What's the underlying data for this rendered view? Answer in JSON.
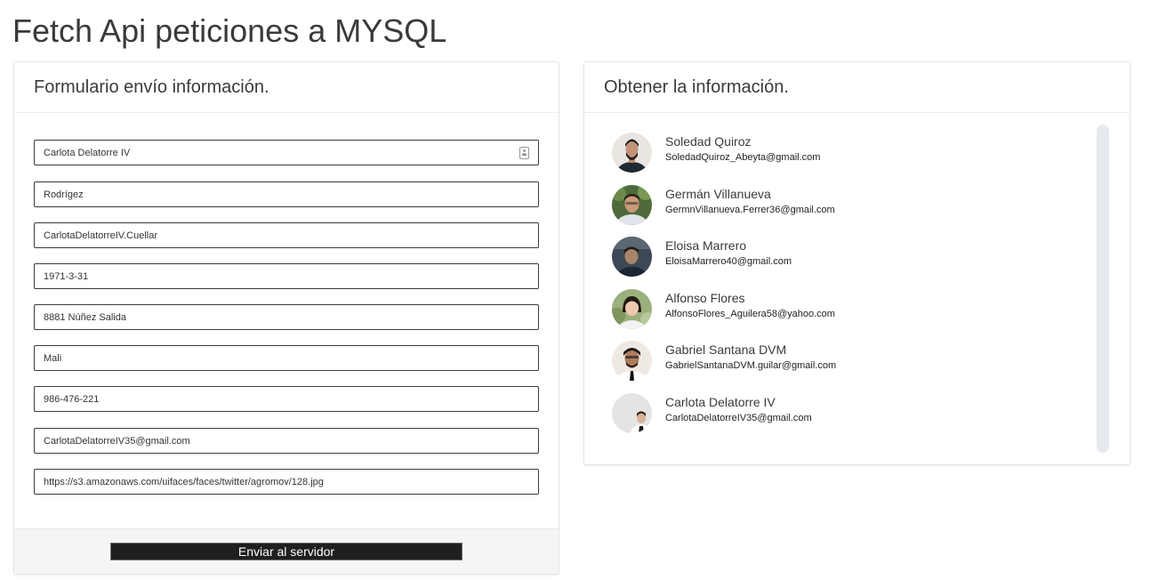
{
  "page": {
    "title": "Fetch Api peticiones a MYSQL"
  },
  "form_card": {
    "title": "Formulario envío información.",
    "fields": [
      {
        "value": "Carlota Delatorre IV"
      },
      {
        "value": "Rodrígez"
      },
      {
        "value": "CarlotaDelatorreIV.Cuellar"
      },
      {
        "value": "1971-3-31"
      },
      {
        "value": "8881 Núñez Salida"
      },
      {
        "value": "Mali"
      },
      {
        "value": "986-476-221"
      },
      {
        "value": "CarlotaDelatorreIV35@gmail.com"
      },
      {
        "value": "https://s3.amazonaws.com/uifaces/faces/twitter/agromov/128.jpg"
      }
    ],
    "submit_label": "Enviar al servidor"
  },
  "list_card": {
    "title": "Obtener la información.",
    "users": [
      {
        "name": "Soledad Quiroz",
        "email": "SoledadQuiroz_Abeyta@gmail.com"
      },
      {
        "name": "Germán Villanueva",
        "email": "GermnVillanueva.Ferrer36@gmail.com"
      },
      {
        "name": "Eloisa Marrero",
        "email": "EloisaMarrero40@gmail.com"
      },
      {
        "name": "Alfonso Flores",
        "email": "AlfonsoFlores_Aguilera58@yahoo.com"
      },
      {
        "name": "Gabriel Santana DVM",
        "email": "GabrielSantanaDVM.guilar@gmail.com"
      },
      {
        "name": "Carlota Delatorre IV",
        "email": "CarlotaDelatorreIV35@gmail.com"
      }
    ]
  },
  "colors": {
    "button_bg": "#1e1f20",
    "footer_bg": "#f4f5f7",
    "scroll_track": "#e6e9ee"
  },
  "icons": {
    "autofill": "contact-card-icon",
    "avatars": "user-avatar-photo"
  }
}
